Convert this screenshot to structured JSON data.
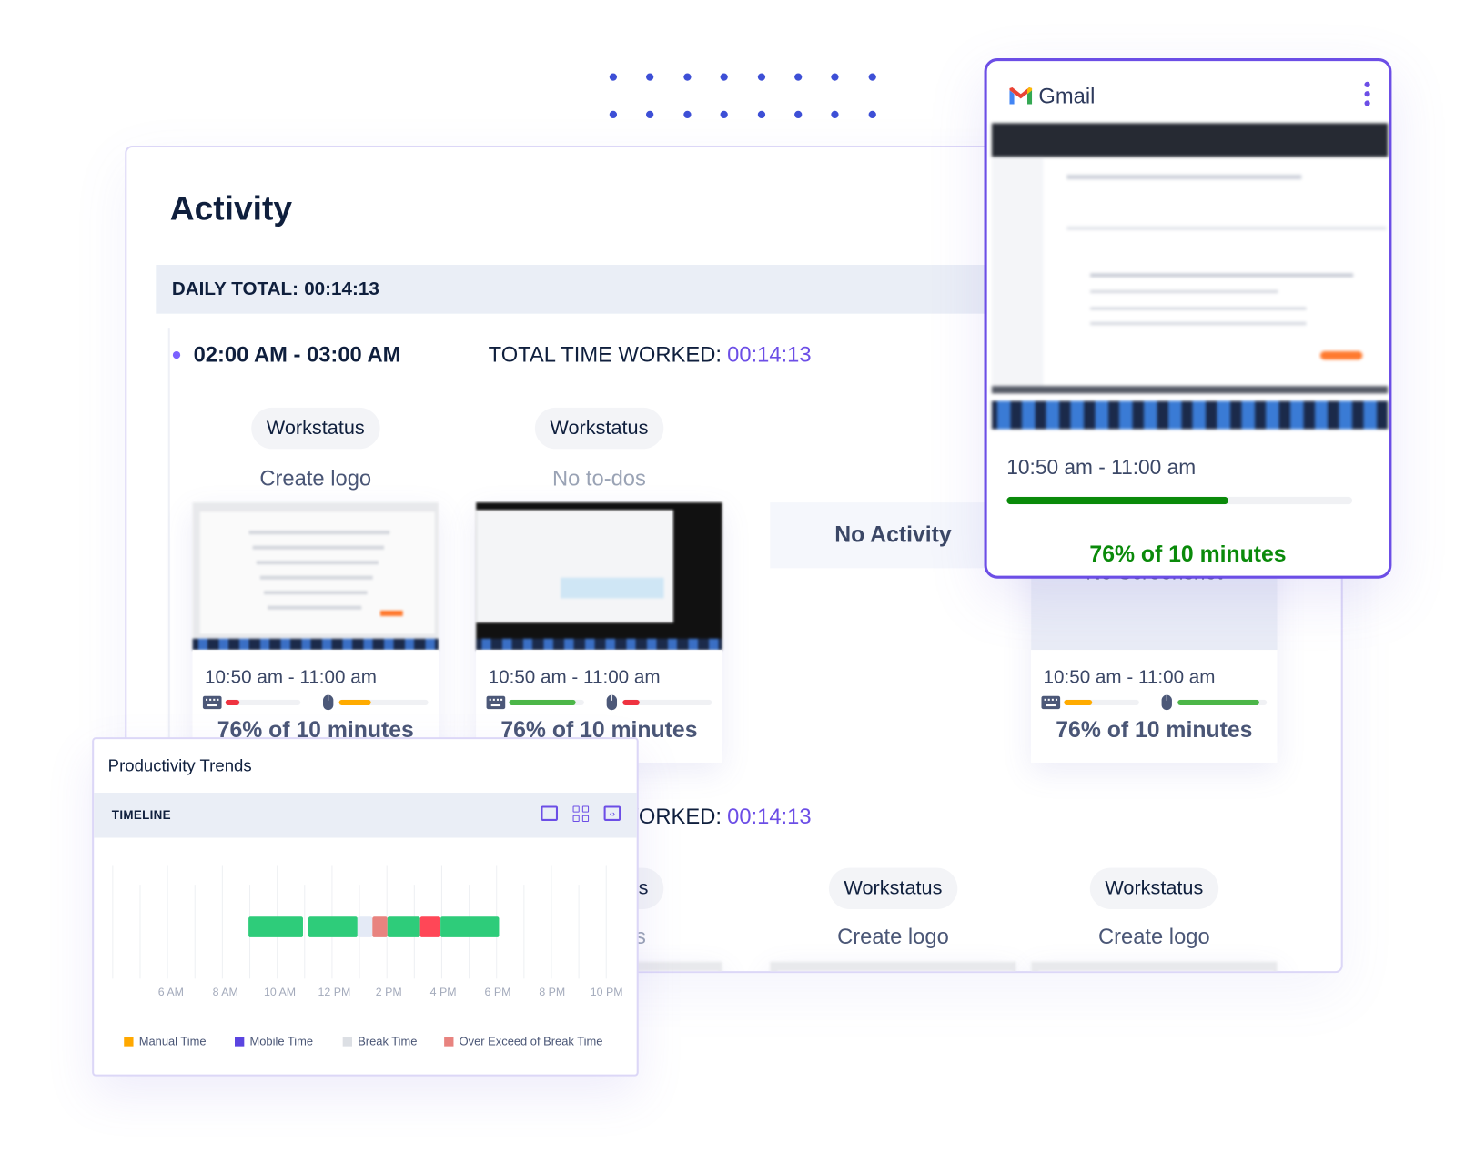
{
  "activity": {
    "title": "Activity",
    "daily_total_label": "DAILY TOTAL:",
    "daily_total_value": "00:14:13"
  },
  "sessions": [
    {
      "range": "02:00 AM - 03:00 AM",
      "total_label": "TOTAL TIME WORKED:",
      "total_value": "00:14:13",
      "cards": [
        {
          "kind": "screenshot",
          "app": "Workstatus",
          "todo": "Create logo",
          "time": "10:50 am - 11:00 am",
          "keyboard_level": 19,
          "keyboard_color": "#ef3340",
          "mouse_level": 36,
          "mouse_color": "#ffab00",
          "summary": "76% of 10 minutes"
        },
        {
          "kind": "screenshot-dark",
          "app": "Workstatus",
          "todo": "No to-dos",
          "time": "10:50 am - 11:00 am",
          "keyboard_level": 89,
          "keyboard_color": "#4cb648",
          "mouse_level": 19,
          "mouse_color": "#ef3340",
          "summary": "76% of 10 minutes"
        },
        {
          "kind": "no-activity",
          "label": "No Activity"
        },
        {
          "kind": "no-screenshot",
          "label": "No Screenshot",
          "time": "10:50 am - 11:00 am",
          "keyboard_level": 38,
          "keyboard_color": "#ffab00",
          "mouse_level": 92,
          "mouse_color": "#4cb648",
          "summary": "76% of 10 minutes"
        }
      ]
    },
    {
      "total_label": "TOTAL TIME WORKED:",
      "total_value": "00:14:13",
      "cards": [
        {
          "app": "Workstatus",
          "todo": "No to-dos"
        },
        {
          "app": "Workstatus",
          "todo": "Create logo"
        },
        {
          "app": "Workstatus",
          "todo": "Create logo"
        }
      ]
    }
  ],
  "productivity": {
    "title": "Productivity Trends",
    "tab": "TIMELINE",
    "view_icons": [
      "screen-icon",
      "grid-icon",
      "code-screen-icon"
    ]
  },
  "chart_data": {
    "type": "timeline",
    "x_unit": "hour of day",
    "tick_labels": [
      "6 AM",
      "8 AM",
      "10 AM",
      "12 PM",
      "2 PM",
      "4 PM",
      "6 PM",
      "8 PM",
      "10 PM"
    ],
    "tick_hours": [
      6,
      8,
      10,
      12,
      14,
      16,
      18,
      20,
      22
    ],
    "segments": [
      {
        "start": 8.85,
        "end": 10.85,
        "color": "#2ecc7a"
      },
      {
        "start": 11.05,
        "end": 12.85,
        "color": "#2ecc7a"
      },
      {
        "start": 12.85,
        "end": 13.4,
        "series": "Break Time",
        "color": "#e4eaf6"
      },
      {
        "start": 13.4,
        "end": 13.95,
        "series": "Over Exceed of Break Time",
        "color": "#e8837f"
      },
      {
        "start": 13.95,
        "end": 15.15,
        "color": "#2ecc7a"
      },
      {
        "start": 15.15,
        "end": 15.9,
        "color": "#ff4757"
      },
      {
        "start": 15.9,
        "end": 18.05,
        "color": "#2ecc7a"
      }
    ],
    "legend": [
      {
        "name": "Manual Time",
        "color": "#ffa800"
      },
      {
        "name": "Mobile Time",
        "color": "#5b45e0"
      },
      {
        "name": "Break Time",
        "color": "#dcdfe4"
      },
      {
        "name": "Over Exceed of Break Time",
        "color": "#e8837f"
      }
    ],
    "legend_position": "bottom",
    "grid": true
  },
  "gmail_popup": {
    "app": "Gmail",
    "time": "10:50 am - 11:00 am",
    "progress_percent": 64,
    "summary": "76% of 10 minutes",
    "accent": "#6c4ee6",
    "progress_color": "#0a8a0a"
  }
}
